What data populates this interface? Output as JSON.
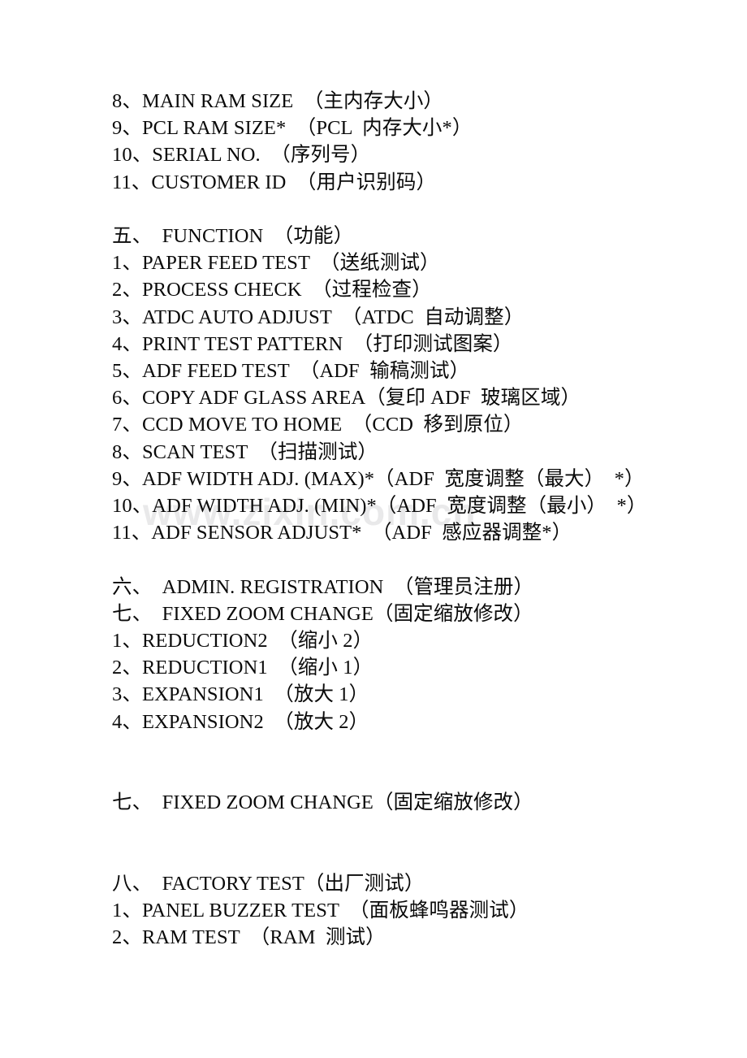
{
  "document": {
    "watermark": "www.zixin.com.cn",
    "page_background": "#ffffff",
    "text_color": "#0a0a0a",
    "watermark_color": "#e9e9ea"
  },
  "lines": [
    {
      "id": "l01",
      "type": "item",
      "text": "8、MAIN RAM SIZE  （主内存大小）"
    },
    {
      "id": "l02",
      "type": "item",
      "text": "9、PCL RAM SIZE*  （PCL  内存大小*）"
    },
    {
      "id": "l03",
      "type": "item",
      "text": "10、SERIAL NO.  （序列号）"
    },
    {
      "id": "l04",
      "type": "item",
      "text": "11、CUSTOMER ID  （用户识别码）"
    },
    {
      "id": "l05",
      "type": "blank",
      "text": ""
    },
    {
      "id": "l06",
      "type": "heading",
      "text": "五、  FUNCTION  （功能）"
    },
    {
      "id": "l07",
      "type": "item",
      "text": "1、PAPER FEED TEST  （送纸测试）"
    },
    {
      "id": "l08",
      "type": "item",
      "text": "2、PROCESS CHECK  （过程检查）"
    },
    {
      "id": "l09",
      "type": "item",
      "text": "3、ATDC AUTO ADJUST  （ATDC  自动调整）"
    },
    {
      "id": "l10",
      "type": "item",
      "text": "4、PRINT TEST PATTERN  （打印测试图案）"
    },
    {
      "id": "l11",
      "type": "item",
      "text": "5、ADF FEED TEST  （ADF  输稿测试）"
    },
    {
      "id": "l12",
      "type": "item",
      "text": "6、COPY ADF GLASS AREA（复印 ADF  玻璃区域）"
    },
    {
      "id": "l13",
      "type": "item",
      "text": "7、CCD MOVE TO HOME  （CCD  移到原位）"
    },
    {
      "id": "l14",
      "type": "item",
      "text": "8、SCAN TEST  （扫描测试）"
    },
    {
      "id": "l15",
      "type": "item",
      "text": "9、ADF WIDTH ADJ. (MAX)*（ADF  宽度调整（最大）  *）"
    },
    {
      "id": "l16",
      "type": "item",
      "text": "10、ADF WIDTH ADJ. (MIN)*（ADF  宽度调整（最小）  *）"
    },
    {
      "id": "l17",
      "type": "item",
      "text": "11、ADF SENSOR ADJUST*  （ADF  感应器调整*）"
    },
    {
      "id": "l18",
      "type": "blank",
      "text": ""
    },
    {
      "id": "l19",
      "type": "heading",
      "text": "六、  ADMIN. REGISTRATION  （管理员注册）"
    },
    {
      "id": "l20",
      "type": "heading",
      "text": "七、  FIXED ZOOM CHANGE（固定缩放修改）"
    },
    {
      "id": "l21",
      "type": "item",
      "text": "1、REDUCTION2  （缩小 2）"
    },
    {
      "id": "l22",
      "type": "item",
      "text": "2、REDUCTION1  （缩小 1）"
    },
    {
      "id": "l23",
      "type": "item",
      "text": "3、EXPANSION1  （放大 1）"
    },
    {
      "id": "l24",
      "type": "item",
      "text": "4、EXPANSION2  （放大 2）"
    },
    {
      "id": "l25",
      "type": "blank",
      "text": ""
    },
    {
      "id": "l26",
      "type": "blank",
      "text": ""
    },
    {
      "id": "l27",
      "type": "heading",
      "text": "七、  FIXED ZOOM CHANGE（固定缩放修改）"
    },
    {
      "id": "l28",
      "type": "blank",
      "text": ""
    },
    {
      "id": "l29",
      "type": "blank",
      "text": ""
    },
    {
      "id": "l30",
      "type": "heading",
      "text": "八、  FACTORY TEST（出厂测试）"
    },
    {
      "id": "l31",
      "type": "item",
      "text": "1、PANEL BUZZER TEST  （面板蜂鸣器测试）"
    },
    {
      "id": "l32",
      "type": "item",
      "text": "2、RAM TEST  （RAM  测试）"
    }
  ]
}
